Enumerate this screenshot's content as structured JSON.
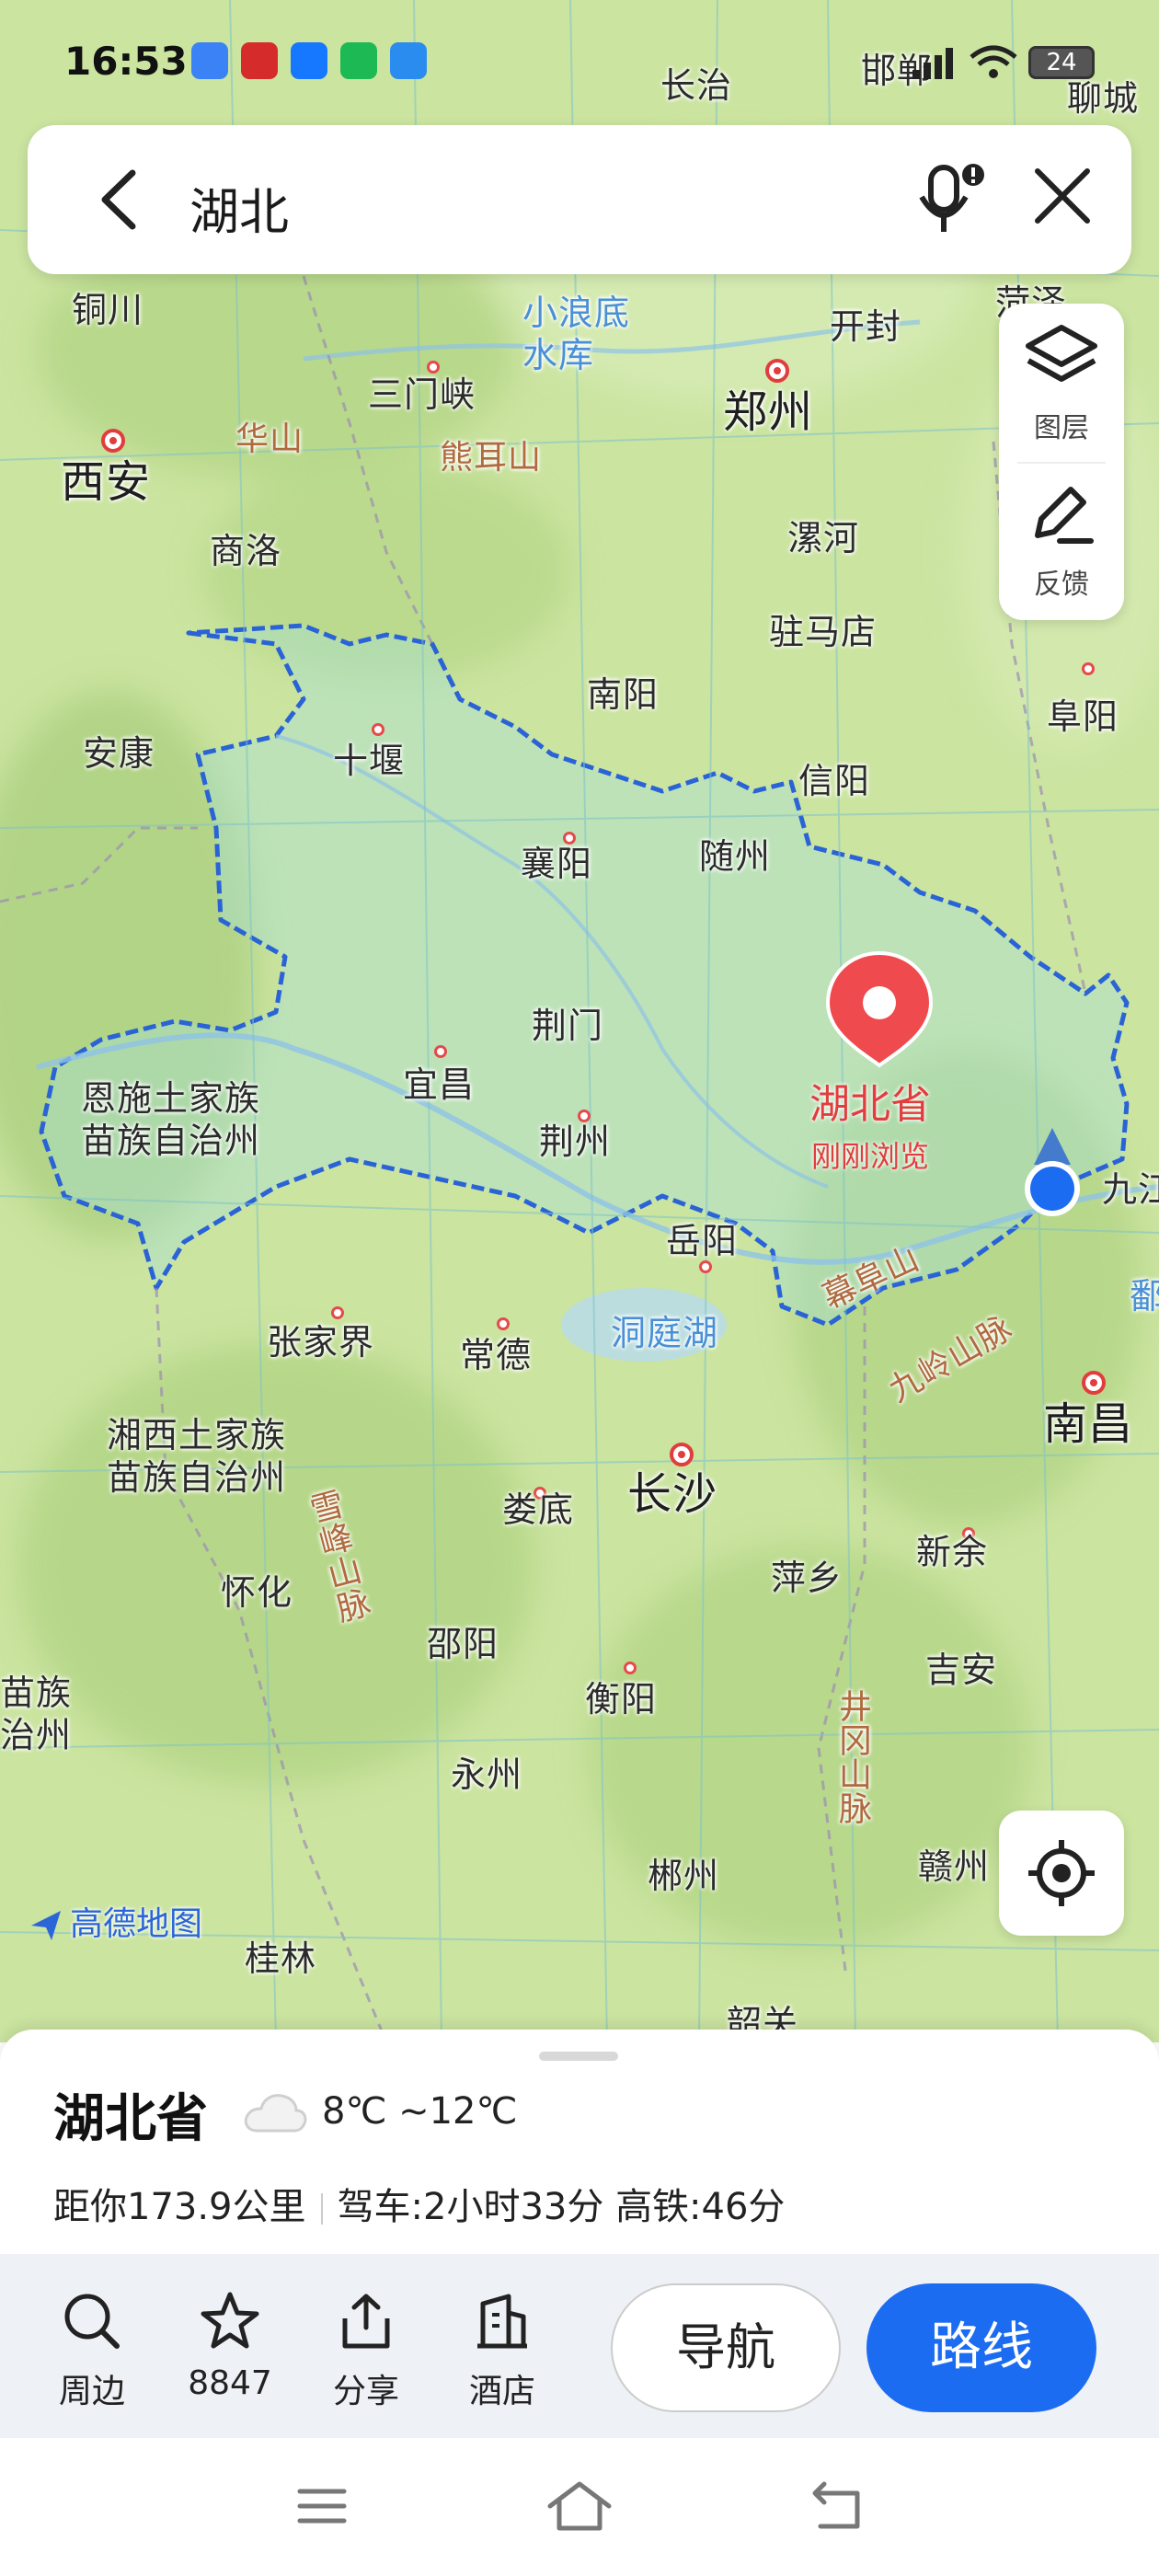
{
  "status_bar": {
    "time": "16:53",
    "battery": "24"
  },
  "search": {
    "query": "湖北"
  },
  "layers_panel": {
    "layers_label": "图层",
    "feedback_label": "反馈"
  },
  "map": {
    "logo_text": "高德地图",
    "province_pin": {
      "name": "湖北省",
      "subtitle": "刚刚浏览"
    },
    "places": {
      "changzhi": "长治",
      "handan": "邯郸",
      "liaocheng": "聊城",
      "tongchuan": "铜川",
      "xiaolangdi": "小浪底\n水库",
      "kaifeng": "开封",
      "heze": "菏泽",
      "sanmenxia": "三门峡",
      "zhengzhou": "郑州",
      "xian": "西安",
      "huashan": "华山",
      "xiongershan": "熊耳山",
      "shangluo": "商洛",
      "luohe": "漯河",
      "zhumadian": "驻马店",
      "nanyang": "南阳",
      "fuyang": "阜阳",
      "ankang": "安康",
      "shiyan": "十堰",
      "xinyang": "信阳",
      "xiangyang": "襄阳",
      "suizhou": "随州",
      "jingmen": "荆门",
      "enshi": "恩施土家族\n苗族自治州",
      "yichang": "宜昌",
      "jingzhou": "荆州",
      "yueyang": "岳阳",
      "jiujiang": "九江",
      "mufushan": "幕阜山",
      "poyang": "鄱",
      "zhangjiajie": "张家界",
      "changde": "常德",
      "dongtinghu": "洞庭湖",
      "jiulingshan": "九岭山脉",
      "nanchang": "南昌",
      "xiangxi": "湘西土家族\n苗族自治州",
      "changsha": "长沙",
      "xuefengshan": "雪峰山脉",
      "loudi": "娄底",
      "xinyu": "新余",
      "pingxiang": "萍乡",
      "huaihua": "怀化",
      "shaoyang": "邵阳",
      "hengyang": "衡阳",
      "jian": "吉安",
      "miaozu": "苗族\n治州",
      "jinggangshan": "井冈山脉",
      "yongzhou": "永州",
      "chenzhou": "郴州",
      "ganzhou": "赣州",
      "guilin": "桂林",
      "shaoguan": "韶关"
    }
  },
  "sheet": {
    "title": "湖北省",
    "weather": "8℃ ~12℃",
    "distance": "距你173.9公里",
    "drive": "驾车:2小时33分",
    "rail": "高铁:46分"
  },
  "actions": {
    "nearby": "周边",
    "favorite_count": "8847",
    "share": "分享",
    "hotel": "酒店",
    "navigate": "导航",
    "route": "路线"
  },
  "colors": {
    "accent": "#1c6cf2",
    "pin_red": "#e23d3d",
    "boundary_blue": "#2a63d6",
    "land_green": "#cfe6a6"
  },
  "icons": [
    "back-icon",
    "mic-icon",
    "close-icon",
    "layers-icon",
    "feedback-icon",
    "locate-icon",
    "search-icon",
    "star-icon",
    "share-icon",
    "hotel-icon",
    "cloud-icon",
    "menu-icon",
    "home-icon",
    "return-icon"
  ]
}
